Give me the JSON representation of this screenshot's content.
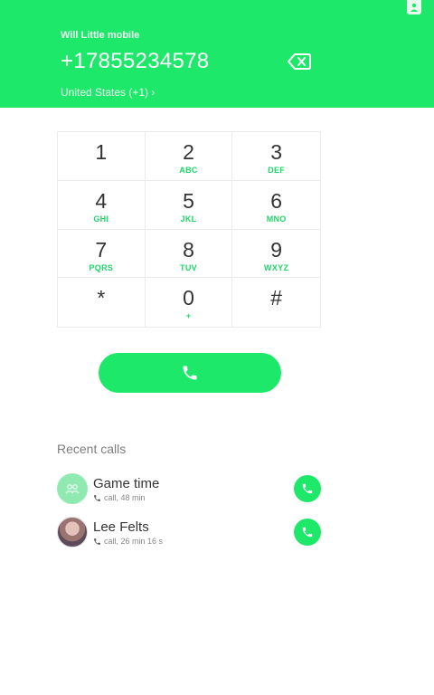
{
  "header": {
    "caller_name": "Will Little mobile",
    "phone_number": "+17855234578",
    "country": "United States (+1) ›",
    "background_color": "#1ee86a"
  },
  "keypad": {
    "keys": [
      {
        "digit": "1",
        "letters": ""
      },
      {
        "digit": "2",
        "letters": "ABC"
      },
      {
        "digit": "3",
        "letters": "DEF"
      },
      {
        "digit": "4",
        "letters": "GHI"
      },
      {
        "digit": "5",
        "letters": "JKL"
      },
      {
        "digit": "6",
        "letters": "MNO"
      },
      {
        "digit": "7",
        "letters": "PQRS"
      },
      {
        "digit": "8",
        "letters": "TUV"
      },
      {
        "digit": "9",
        "letters": "WXYZ"
      },
      {
        "digit": "*",
        "letters": ""
      },
      {
        "digit": "0",
        "letters": "+"
      },
      {
        "digit": "#",
        "letters": ""
      }
    ],
    "accent_color": "#1ed766"
  },
  "call_button": {
    "icon": "phone-icon"
  },
  "recent": {
    "title": "Recent calls",
    "items": [
      {
        "name": "Game time",
        "detail": "call, 48 min",
        "avatar": "group-icon"
      },
      {
        "name": "Lee Felts",
        "detail": "call, 26 min 16 s",
        "avatar": "photo"
      }
    ]
  }
}
